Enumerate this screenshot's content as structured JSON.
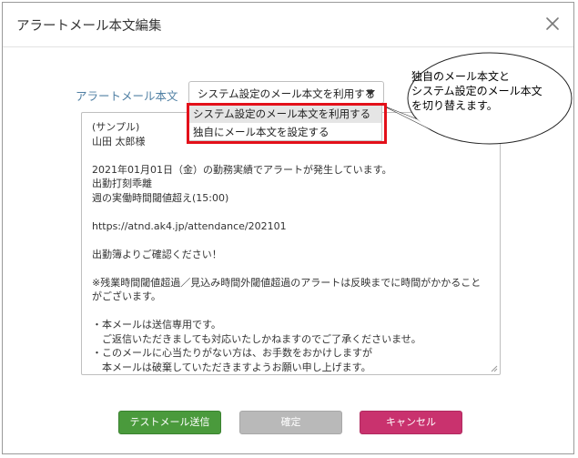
{
  "dialog": {
    "title": "アラートメール本文編集"
  },
  "form": {
    "field_label": "アラートメール本文",
    "select": {
      "value": "システム設定のメール本文を利用する",
      "options": [
        "システム設定のメール本文を利用する",
        "独自にメール本文を設定する"
      ]
    },
    "body": "(サンプル)\n山田 太郎様\n\n2021年01月01日（金）の勤務実績でアラートが発生しています。\n出勤打刻乖離\n週の実働時間閾値超え(15:00)\n\nhttps://atnd.ak4.jp/attendance/202101\n\n出勤簿よりご確認ください！\n\n※残業時間閾値超過／見込み時間外閾値超過のアラートは反映までに時間がかかることがございます。\n\n・本メールは送信専用です。\n　ご返信いただきましても対応いたしかねますのでご了承くださいませ。\n・このメールに心当たりがない方は、お手数をおかけしますが\n　本メールは破棄していただきますようお願い申し上げます。"
  },
  "callout": {
    "lines": [
      "独自のメール本文と",
      "システム設定のメール本文",
      "を切り替えます。"
    ]
  },
  "buttons": {
    "test": "テストメール送信",
    "confirm": "確定",
    "cancel": "キャンセル"
  },
  "colors": {
    "label": "#4f7fa3",
    "highlight": "#e3101a",
    "test_button": "#4a9a3c",
    "confirm_button": "#b9b9b9",
    "cancel_button": "#c9326e"
  },
  "icons": {
    "close": "close-icon",
    "caret": "chevron-down-icon",
    "resize": "resize-grip-icon"
  }
}
